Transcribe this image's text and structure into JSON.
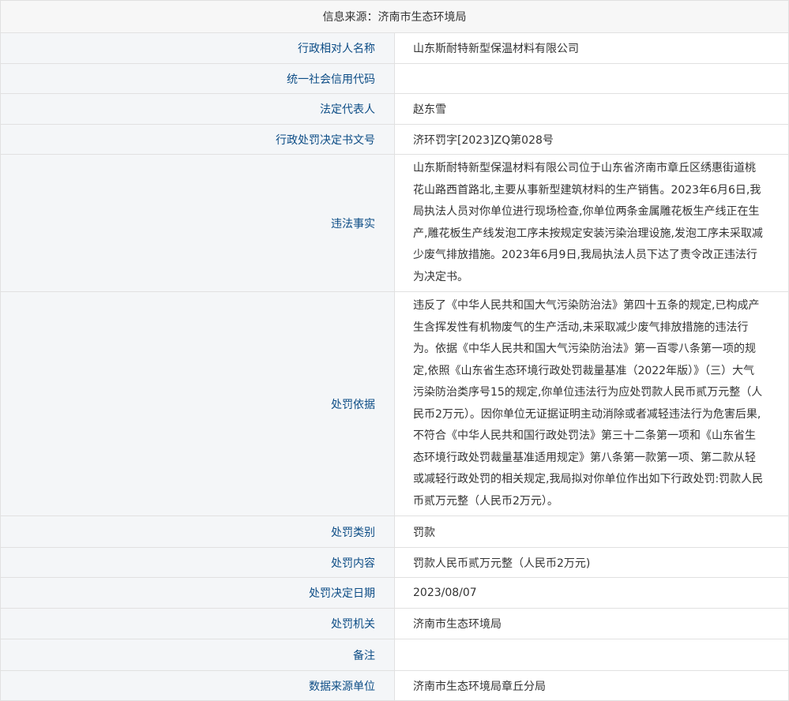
{
  "header": {
    "source": "信息来源：济南市生态环境局"
  },
  "rows": [
    {
      "label": "行政相对人名称",
      "value": "山东斯耐特新型保温材料有限公司"
    },
    {
      "label": "统一社会信用代码",
      "value": ""
    },
    {
      "label": "法定代表人",
      "value": "赵东雪"
    },
    {
      "label": "行政处罚决定书文号",
      "value": "济环罚字[2023]ZQ第028号"
    },
    {
      "label": "违法事实",
      "value": "山东斯耐特新型保温材料有限公司位于山东省济南市章丘区绣惠街道桃花山路西首路北,主要从事新型建筑材料的生产销售。2023年6月6日,我局执法人员对你单位进行现场检查,你单位两条金属雕花板生产线正在生产,雕花板生产线发泡工序未按规定安装污染治理设施,发泡工序未采取减少废气排放措施。2023年6月9日,我局执法人员下达了责令改正违法行为决定书。"
    },
    {
      "label": "处罚依据",
      "value": "违反了《中华人民共和国大气污染防治法》第四十五条的规定,已构成产生含挥发性有机物废气的生产活动,未采取减少废气排放措施的违法行为。依据《中华人民共和国大气污染防治法》第一百零八条第一项的规定,依照《山东省生态环境行政处罚裁量基准（2022年版）》（三）大气污染防治类序号15的规定,你单位违法行为应处罚款人民币贰万元整（人民币2万元）。因你单位无证据证明主动消除或者减轻违法行为危害后果,不符合《中华人民共和国行政处罚法》第三十二条第一项和《山东省生态环境行政处罚裁量基准适用规定》第八条第一款第一项、第二款从轻或减轻行政处罚的相关规定,我局拟对你单位作出如下行政处罚:罚款人民币贰万元整（人民币2万元）。"
    },
    {
      "label": "处罚类别",
      "value": "罚款"
    },
    {
      "label": "处罚内容",
      "value": "罚款人民币贰万元整（人民币2万元)"
    },
    {
      "label": "处罚决定日期",
      "value": "2023/08/07"
    },
    {
      "label": "处罚机关",
      "value": "济南市生态环境局"
    },
    {
      "label": "备注",
      "value": ""
    },
    {
      "label": "数据来源单位",
      "value": "济南市生态环境局章丘分局"
    }
  ]
}
